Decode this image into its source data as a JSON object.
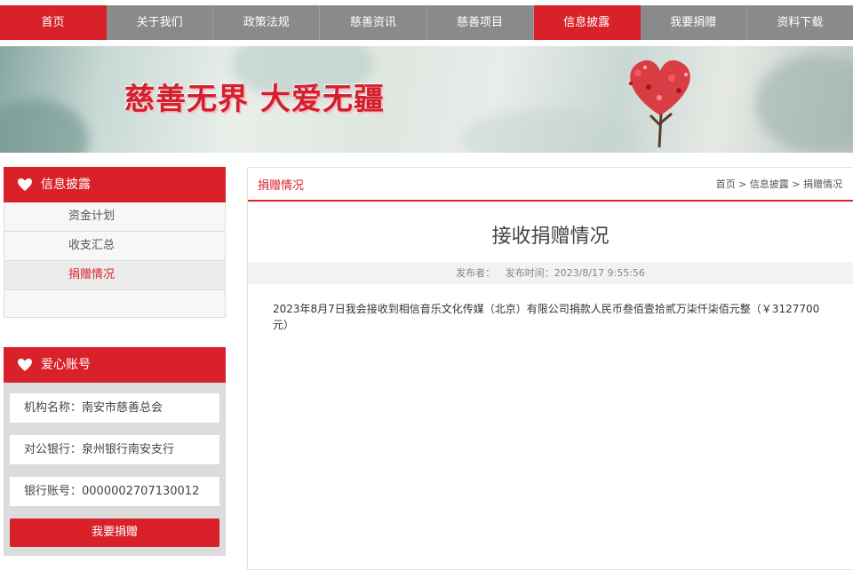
{
  "nav": {
    "items": [
      "首页",
      "关于我们",
      "政策法规",
      "慈善资讯",
      "慈善项目",
      "信息披露",
      "我要捐赠",
      "资料下载"
    ]
  },
  "banner": {
    "slogan": "慈善无界 大爱无疆"
  },
  "info_panel": {
    "title": "信息披露",
    "items": [
      "资金计划",
      "收支汇总",
      "捐赠情况"
    ],
    "active": "捐赠情况"
  },
  "account_panel": {
    "title": "爱心账号",
    "org_name": "机构名称：南安市慈善总会",
    "bank": "对公银行：泉州银行南安支行",
    "account_no": "银行账号：0000002707130012",
    "donate_label": "我要捐赠"
  },
  "article": {
    "section": "捐赠情况",
    "breadcrumb": "首页 > 信息披露 > 捐赠情况",
    "title": "接收捐赠情况",
    "publisher": "发布者：",
    "publish_time": "发布时间：2023/8/17 9:55:56",
    "body": "2023年8月7日我会接收到相信音乐文化传媒（北京）有限公司捐款人民币叁佰壹拾贰万柒仟柒佰元整（￥3127700元）"
  },
  "colors": {
    "accent": "#d9212a",
    "nav_gray": "#8a8a8a"
  }
}
